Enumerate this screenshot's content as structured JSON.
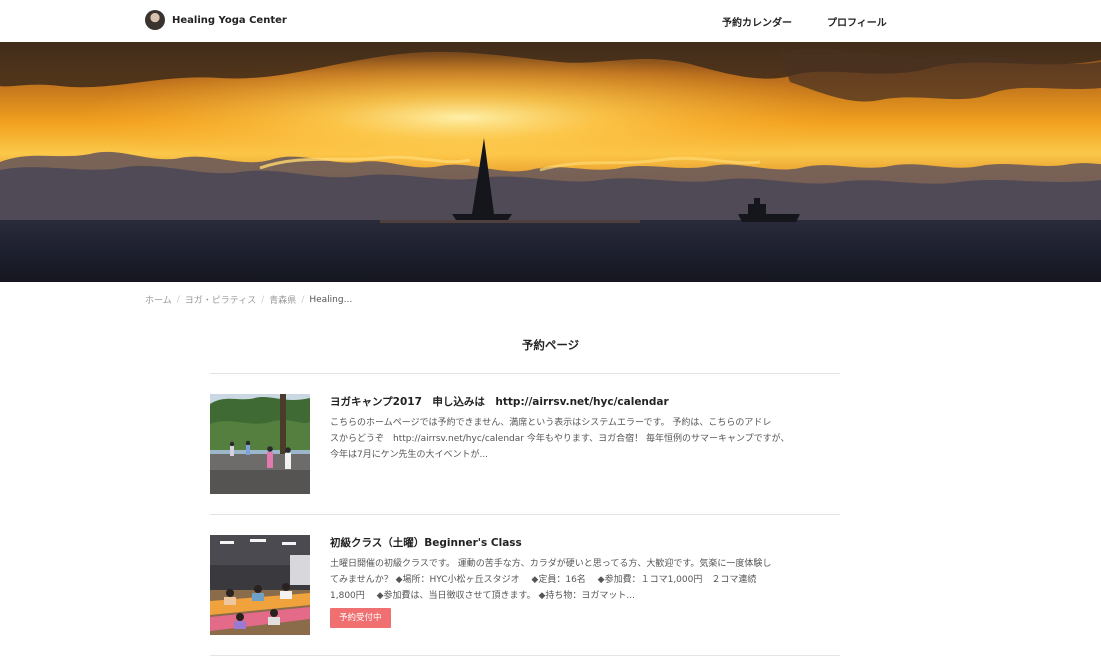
{
  "header": {
    "brand_name": "Healing Yoga Center",
    "nav": [
      "予約カレンダー",
      "プロフィール"
    ]
  },
  "breadcrumb": [
    "ホーム",
    "ヨガ・ピラティス",
    "青森県",
    "Healing..."
  ],
  "page_title": "予約ページ",
  "entries": [
    {
      "title": "ヨガキャンプ2017　申し込みは　http://airrsv.net/hyc/calendar",
      "desc_lines": [
        "こちらのホームページでは予約できません、満席という表示はシステムエラーです。 予約は、こちらのアドレ",
        "スからどうぞ　http://airrsv.net/hyc/calendar 今年もやります、ヨガ合宿！ 毎年恒例のサマーキャンプですが、",
        "今年は7月にケン先生の大イベントが..."
      ]
    },
    {
      "title": "初級クラス（土曜）Beginner's Class",
      "desc_lines": [
        "土曜日開催の初級クラスです。 運動の苦手な方、カラダが硬いと思ってる方、大歓迎です。気楽に一度体験し",
        "てみませんか？ ◆場所：HYC小松ヶ丘スタジオ　 ◆定員：16名　 ◆参加費：１コマ1,000円　２コマ連続",
        "1,800円　 ◆参加費は、当日徴収させて頂きます。 ◆持ち物：ヨガマット..."
      ],
      "badge": "予約受付中"
    }
  ],
  "colors": {
    "badge": "#f07071",
    "divider": "#e4e4e4"
  }
}
